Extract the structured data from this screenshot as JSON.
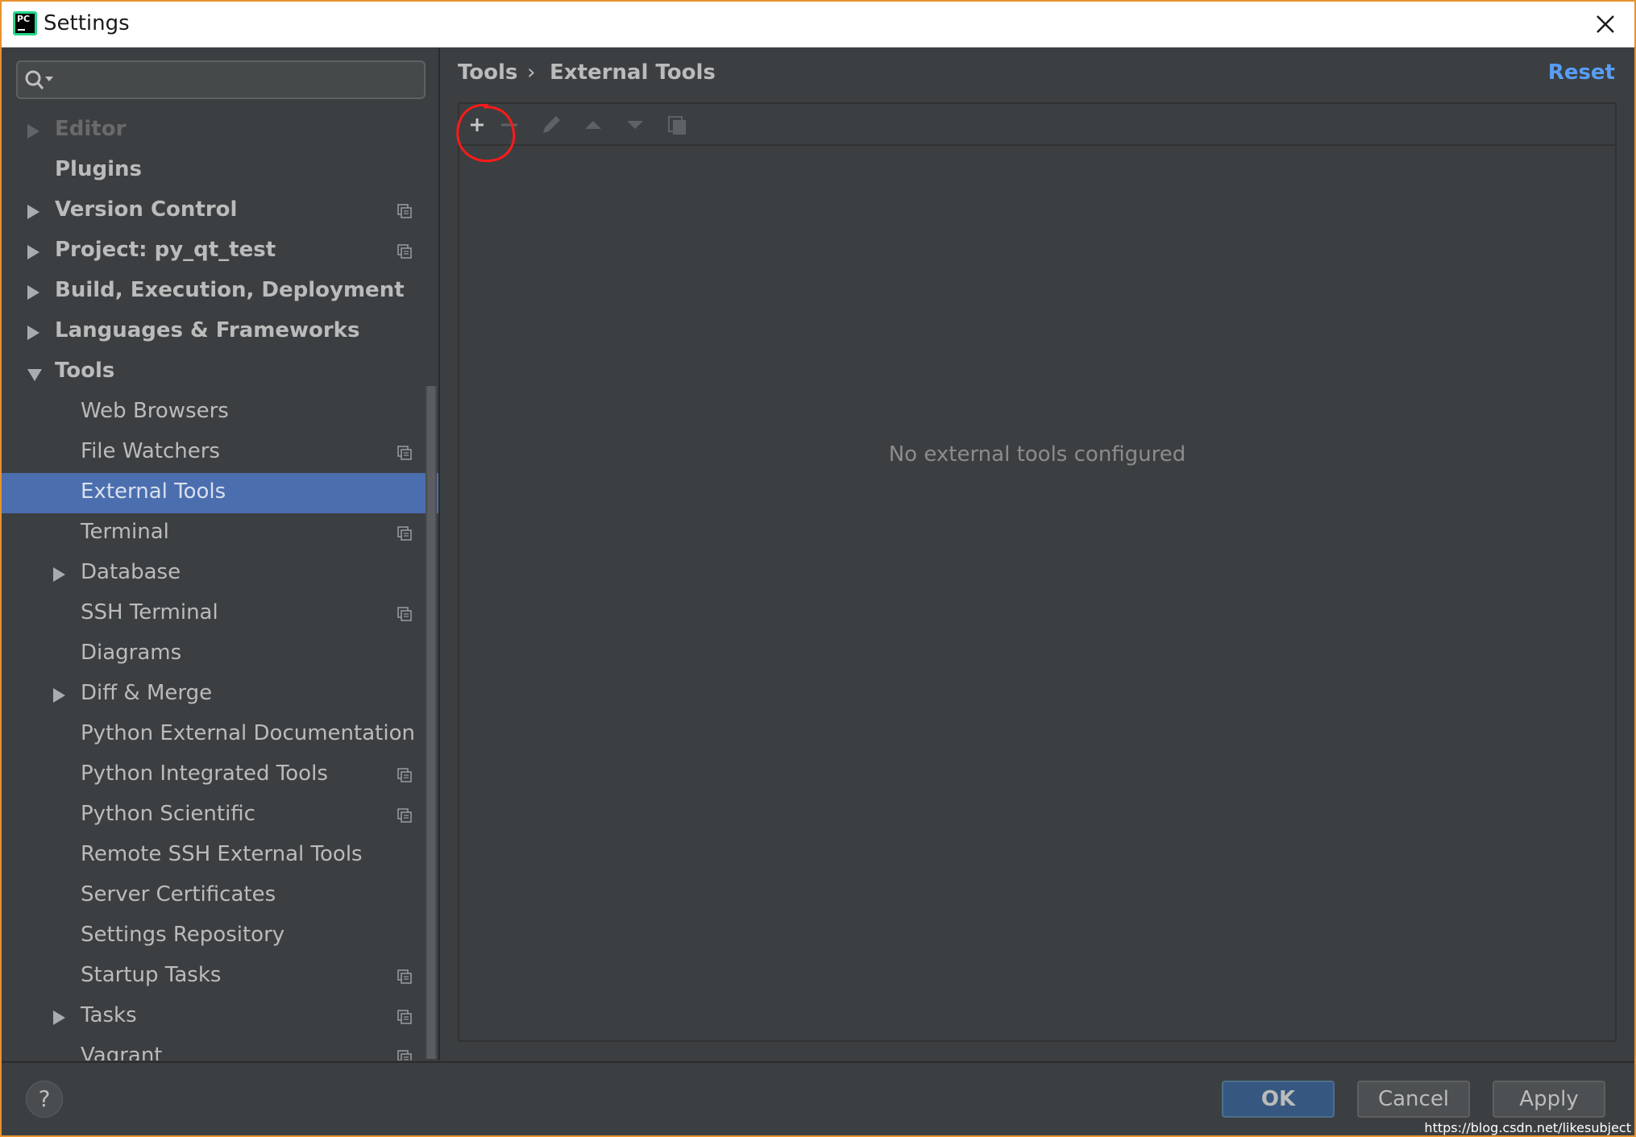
{
  "window": {
    "title": "Settings"
  },
  "search": {
    "placeholder": ""
  },
  "sidebar": {
    "items": [
      {
        "label": "Editor",
        "bold": true,
        "expandable": true,
        "expanded": false,
        "indent": 0,
        "project_icon": false,
        "selected": false,
        "partial": true
      },
      {
        "label": "Plugins",
        "bold": true,
        "expandable": false,
        "indent": 0,
        "project_icon": false,
        "selected": false
      },
      {
        "label": "Version Control",
        "bold": true,
        "expandable": true,
        "expanded": false,
        "indent": 0,
        "project_icon": true,
        "selected": false
      },
      {
        "label": "Project: py_qt_test",
        "bold": true,
        "expandable": true,
        "expanded": false,
        "indent": 0,
        "project_icon": true,
        "selected": false
      },
      {
        "label": "Build, Execution, Deployment",
        "bold": true,
        "expandable": true,
        "expanded": false,
        "indent": 0,
        "project_icon": false,
        "selected": false
      },
      {
        "label": "Languages & Frameworks",
        "bold": true,
        "expandable": true,
        "expanded": false,
        "indent": 0,
        "project_icon": false,
        "selected": false
      },
      {
        "label": "Tools",
        "bold": true,
        "expandable": true,
        "expanded": true,
        "indent": 0,
        "project_icon": false,
        "selected": false
      },
      {
        "label": "Web Browsers",
        "bold": false,
        "expandable": false,
        "indent": 1,
        "project_icon": false,
        "selected": false
      },
      {
        "label": "File Watchers",
        "bold": false,
        "expandable": false,
        "indent": 1,
        "project_icon": true,
        "selected": false
      },
      {
        "label": "External Tools",
        "bold": false,
        "expandable": false,
        "indent": 1,
        "project_icon": false,
        "selected": true
      },
      {
        "label": "Terminal",
        "bold": false,
        "expandable": false,
        "indent": 1,
        "project_icon": true,
        "selected": false
      },
      {
        "label": "Database",
        "bold": false,
        "expandable": true,
        "expanded": false,
        "indent": 1,
        "project_icon": false,
        "selected": false
      },
      {
        "label": "SSH Terminal",
        "bold": false,
        "expandable": false,
        "indent": 1,
        "project_icon": true,
        "selected": false
      },
      {
        "label": "Diagrams",
        "bold": false,
        "expandable": false,
        "indent": 1,
        "project_icon": false,
        "selected": false
      },
      {
        "label": "Diff & Merge",
        "bold": false,
        "expandable": true,
        "expanded": false,
        "indent": 1,
        "project_icon": false,
        "selected": false
      },
      {
        "label": "Python External Documentation",
        "bold": false,
        "expandable": false,
        "indent": 1,
        "project_icon": false,
        "selected": false
      },
      {
        "label": "Python Integrated Tools",
        "bold": false,
        "expandable": false,
        "indent": 1,
        "project_icon": true,
        "selected": false
      },
      {
        "label": "Python Scientific",
        "bold": false,
        "expandable": false,
        "indent": 1,
        "project_icon": true,
        "selected": false
      },
      {
        "label": "Remote SSH External Tools",
        "bold": false,
        "expandable": false,
        "indent": 1,
        "project_icon": false,
        "selected": false
      },
      {
        "label": "Server Certificates",
        "bold": false,
        "expandable": false,
        "indent": 1,
        "project_icon": false,
        "selected": false
      },
      {
        "label": "Settings Repository",
        "bold": false,
        "expandable": false,
        "indent": 1,
        "project_icon": false,
        "selected": false
      },
      {
        "label": "Startup Tasks",
        "bold": false,
        "expandable": false,
        "indent": 1,
        "project_icon": true,
        "selected": false
      },
      {
        "label": "Tasks",
        "bold": false,
        "expandable": true,
        "expanded": false,
        "indent": 1,
        "project_icon": true,
        "selected": false
      },
      {
        "label": "Vagrant",
        "bold": false,
        "expandable": false,
        "indent": 1,
        "project_icon": true,
        "selected": false
      }
    ]
  },
  "content": {
    "breadcrumb": {
      "parent": "Tools",
      "separator": "›",
      "current": "External Tools"
    },
    "reset_label": "Reset",
    "toolbar": {
      "buttons": [
        {
          "name": "add-button",
          "icon": "plus-icon",
          "enabled": true
        },
        {
          "name": "remove-button",
          "icon": "minus-icon",
          "enabled": false
        },
        {
          "name": "edit-button",
          "icon": "pencil-icon",
          "enabled": false
        },
        {
          "name": "move-up-button",
          "icon": "arrow-up-icon",
          "enabled": false
        },
        {
          "name": "move-down-button",
          "icon": "arrow-down-icon",
          "enabled": false
        },
        {
          "name": "copy-button",
          "icon": "copy-icon",
          "enabled": false
        }
      ]
    },
    "empty_text": "No external tools configured"
  },
  "footer": {
    "help_label": "?",
    "ok_label": "OK",
    "cancel_label": "Cancel",
    "apply_label": "Apply"
  },
  "watermark": "https://blog.csdn.net/likesubject",
  "colors": {
    "window_border": "#e8922f",
    "background": "#3c3f41",
    "selection": "#4b6eaf",
    "link": "#589df6",
    "annotation_circle": "#ff1a1a"
  }
}
